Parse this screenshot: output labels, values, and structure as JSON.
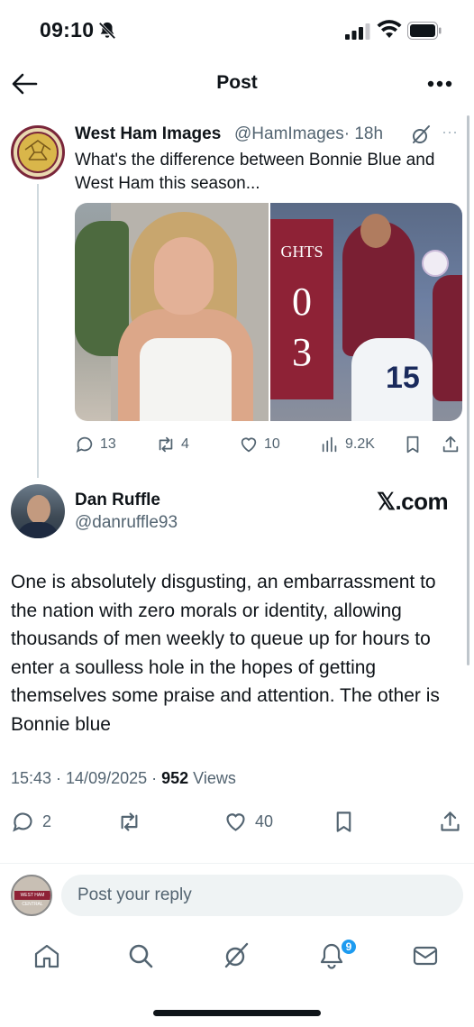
{
  "status_bar": {
    "time": "09:10",
    "icons": [
      "bell-off-icon",
      "signal-icon",
      "wifi-icon",
      "battery-icon"
    ]
  },
  "header": {
    "title": "Post",
    "back_icon": "arrow-left-icon",
    "more_icon": "more-horizontal-icon"
  },
  "parent_post": {
    "author_name": "West Ham Images",
    "handle": "@HamImages",
    "time": "· 18h",
    "text": "What's the difference between Bonnie Blue and West Ham this season...",
    "media": {
      "scoreboard_label": "GHTS",
      "score_home": "0",
      "score_away": "3",
      "shirt_number": "15"
    },
    "stats": {
      "replies": "13",
      "reposts": "4",
      "likes": "10",
      "views": "9.2K"
    }
  },
  "reply": {
    "author_name": "Dan Ruffle",
    "handle": "@danruffle93",
    "source": "𝕏.com",
    "text": "One is absolutely disgusting, an embarrassment to the nation with zero morals or identity, allowing thousands of men weekly to queue up for hours to enter a soulless hole in the hopes of getting themselves some praise and attention. The other is Bonnie blue",
    "timestamp": "15:43 · 14/09/2025 · ",
    "views_count": "952",
    "views_label": " Views",
    "stats": {
      "replies": "2",
      "likes": "40"
    }
  },
  "composer": {
    "placeholder": "Post your reply",
    "avatar_text": "WEST HAM CENTRAL"
  },
  "bottom_nav": {
    "items": [
      "home-icon",
      "search-icon",
      "grok-icon",
      "notifications-icon",
      "messages-icon"
    ],
    "notification_badge": "9"
  },
  "colors": {
    "text": "#0f1419",
    "muted": "#536471",
    "accent": "#1d9bf0",
    "claret": "#7a263a"
  }
}
